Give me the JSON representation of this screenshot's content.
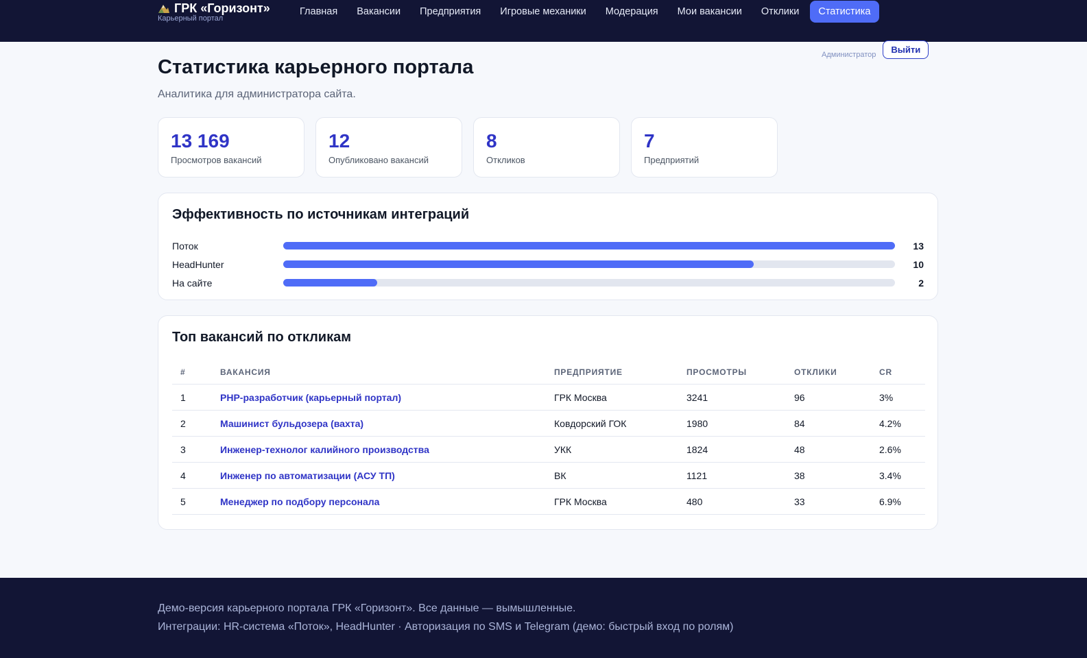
{
  "brand": {
    "title": "ГРК «Горизонт»",
    "subtitle": "Карьерный портал",
    "logo_icon": "mountain-icon"
  },
  "nav": {
    "items": [
      "Главная",
      "Вакансии",
      "Предприятия",
      "Игровые механики",
      "Модерация",
      "Мои вакансии",
      "Отклики",
      "Статистика"
    ],
    "active": "Статистика"
  },
  "user": {
    "role": "Администратор",
    "logout_label": "Выйти"
  },
  "page": {
    "title": "Статистика карьерного портала",
    "subtitle": "Аналитика для администратора сайта."
  },
  "stats": [
    {
      "value": "13 169",
      "label": "Просмотров вакансий"
    },
    {
      "value": "12",
      "label": "Опубликовано вакансий"
    },
    {
      "value": "8",
      "label": "Откликов"
    },
    {
      "value": "7",
      "label": "Предприятий"
    }
  ],
  "sources": {
    "title": "Эффективность по источникам интеграций",
    "rows": [
      {
        "label": "Поток",
        "value": 13,
        "value_text": "13"
      },
      {
        "label": "HeadHunter",
        "value": 10,
        "value_text": "10"
      },
      {
        "label": "На сайте",
        "value": 2,
        "value_text": "2"
      }
    ],
    "max": 13
  },
  "top": {
    "title": "Топ вакансий по откликам",
    "columns": [
      "#",
      "ВАКАНСИЯ",
      "ПРЕДПРИЯТИЕ",
      "ПРОСМОТРЫ",
      "ОТКЛИКИ",
      "CR"
    ],
    "rows": [
      [
        "1",
        "PHP-разработчик (карьерный портал)",
        "ГРК Москва",
        "3241",
        "96",
        "3%"
      ],
      [
        "2",
        "Машинист бульдозера (вахта)",
        "Ковдорский ГОК",
        "1980",
        "84",
        "4.2%"
      ],
      [
        "3",
        "Инженер-технолог калийного производства",
        "УКК",
        "1824",
        "48",
        "2.6%"
      ],
      [
        "4",
        "Инженер по автоматизации (АСУ ТП)",
        "ВК",
        "1121",
        "38",
        "3.4%"
      ],
      [
        "5",
        "Менеджер по подбору персонала",
        "ГРК Москва",
        "480",
        "33",
        "6.9%"
      ]
    ]
  },
  "footer": {
    "line1": "Демо-версия карьерного портала ГРК «Горизонт». Все данные — вымышленные.",
    "line2": "Интеграции: HR-система «Поток», HeadHunter · Авторизация по SMS и Telegram (демо: быстрый вход по ролям)"
  },
  "colors": {
    "accent": "#4f6cf7",
    "header_bg": "#121535",
    "link": "#2f34c6"
  }
}
